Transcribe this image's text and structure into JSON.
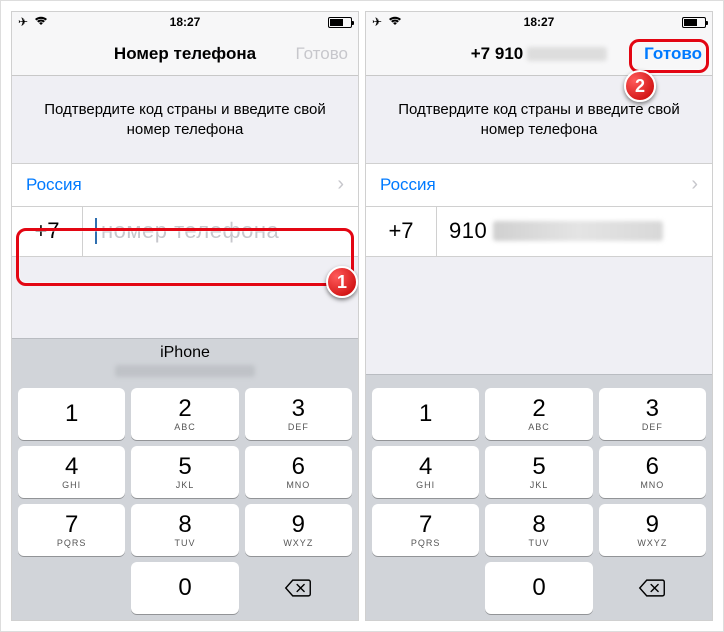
{
  "statusbar": {
    "time": "18:27"
  },
  "screen1": {
    "title": "Номер телефона",
    "done": "Готово",
    "instruction": "Подтвердите код страны и введите свой номер телефона",
    "country": "Россия",
    "countryCode": "+7",
    "phonePlaceholder": "номер телефона",
    "suggest": "iPhone"
  },
  "screen2": {
    "titlePrefix": "+7 910",
    "done": "Готово",
    "instruction": "Подтвердите код страны и введите свой номер телефона",
    "country": "Россия",
    "countryCode": "+7",
    "phoneEntered": "910"
  },
  "keypad": [
    [
      {
        "n": "1",
        "l": ""
      },
      {
        "n": "2",
        "l": "ABC"
      },
      {
        "n": "3",
        "l": "DEF"
      }
    ],
    [
      {
        "n": "4",
        "l": "GHI"
      },
      {
        "n": "5",
        "l": "JKL"
      },
      {
        "n": "6",
        "l": "MNO"
      }
    ],
    [
      {
        "n": "7",
        "l": "PQRS"
      },
      {
        "n": "8",
        "l": "TUV"
      },
      {
        "n": "9",
        "l": "WXYZ"
      }
    ],
    [
      {
        "blank": true
      },
      {
        "n": "0",
        "l": ""
      },
      {
        "backspace": true
      }
    ]
  ],
  "badges": {
    "one": "1",
    "two": "2"
  }
}
